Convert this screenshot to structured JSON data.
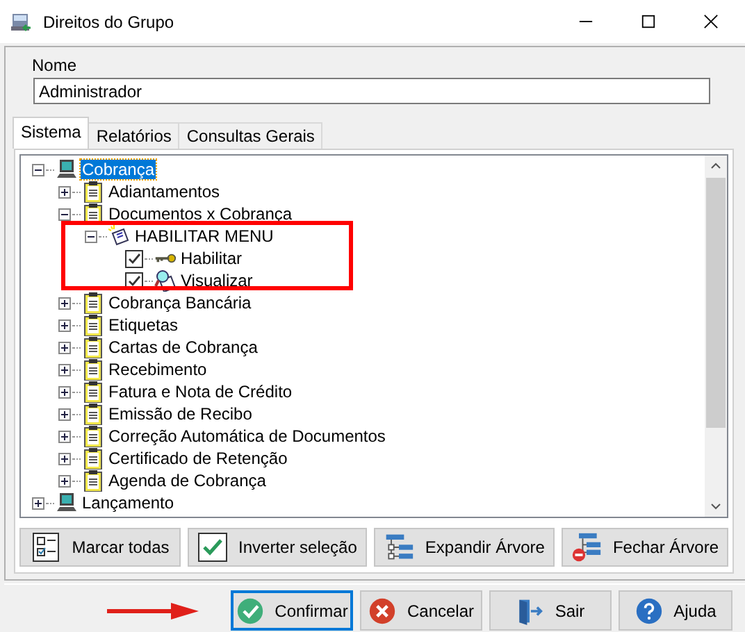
{
  "window": {
    "title": "Direitos do Grupo"
  },
  "name_field": {
    "label": "Nome",
    "value": "Administrador"
  },
  "tabs": [
    {
      "label": "Sistema",
      "selected": true
    },
    {
      "label": "Relatórios",
      "selected": false
    },
    {
      "label": "Consultas Gerais",
      "selected": false
    }
  ],
  "tree": [
    {
      "kind": "module",
      "label": "Cobrança",
      "expanded": true,
      "selected": true,
      "children": [
        {
          "kind": "screen",
          "label": "Adiantamentos",
          "expanded": false,
          "selected": false
        },
        {
          "kind": "screen",
          "label": "Documentos x Cobrança",
          "expanded": true,
          "selected": false,
          "children": [
            {
              "kind": "menu",
              "label": "HABILITAR MENU",
              "expanded": true,
              "selected": false,
              "children": [
                {
                  "kind": "key",
                  "label": "Habilitar",
                  "checked": true,
                  "selected": false
                },
                {
                  "kind": "view",
                  "label": "Visualizar",
                  "checked": true,
                  "selected": false
                }
              ]
            }
          ]
        },
        {
          "kind": "screen",
          "label": "Cobrança Bancária",
          "expanded": false,
          "selected": false
        },
        {
          "kind": "screen",
          "label": "Etiquetas",
          "expanded": false,
          "selected": false
        },
        {
          "kind": "screen",
          "label": "Cartas de Cobrança",
          "expanded": false,
          "selected": false
        },
        {
          "kind": "screen",
          "label": "Recebimento",
          "expanded": false,
          "selected": false
        },
        {
          "kind": "screen",
          "label": "Fatura e Nota de Crédito",
          "expanded": false,
          "selected": false
        },
        {
          "kind": "screen",
          "label": "Emissão de Recibo",
          "expanded": false,
          "selected": false
        },
        {
          "kind": "screen",
          "label": "Correção Automática de Documentos",
          "expanded": false,
          "selected": false
        },
        {
          "kind": "screen",
          "label": "Certificado de Retenção",
          "expanded": false,
          "selected": false
        },
        {
          "kind": "screen",
          "label": "Agenda de Cobrança",
          "expanded": false,
          "selected": false
        }
      ]
    },
    {
      "kind": "module",
      "label": "Lançamento",
      "expanded": false,
      "selected": false
    }
  ],
  "tree_buttons": [
    {
      "kind": "mark-all",
      "label": "Marcar todas"
    },
    {
      "kind": "invert",
      "label": "Inverter seleção"
    },
    {
      "kind": "expand",
      "label": "Expandir Árvore"
    },
    {
      "kind": "collapse",
      "label": "Fechar Árvore"
    }
  ],
  "dialog_buttons": [
    {
      "kind": "confirm",
      "label": "Confirmar",
      "focused": true
    },
    {
      "kind": "cancel",
      "label": "Cancelar",
      "focused": false
    },
    {
      "kind": "exit",
      "label": "Sair",
      "focused": false
    },
    {
      "kind": "help",
      "label": "Ajuda",
      "focused": false
    }
  ]
}
